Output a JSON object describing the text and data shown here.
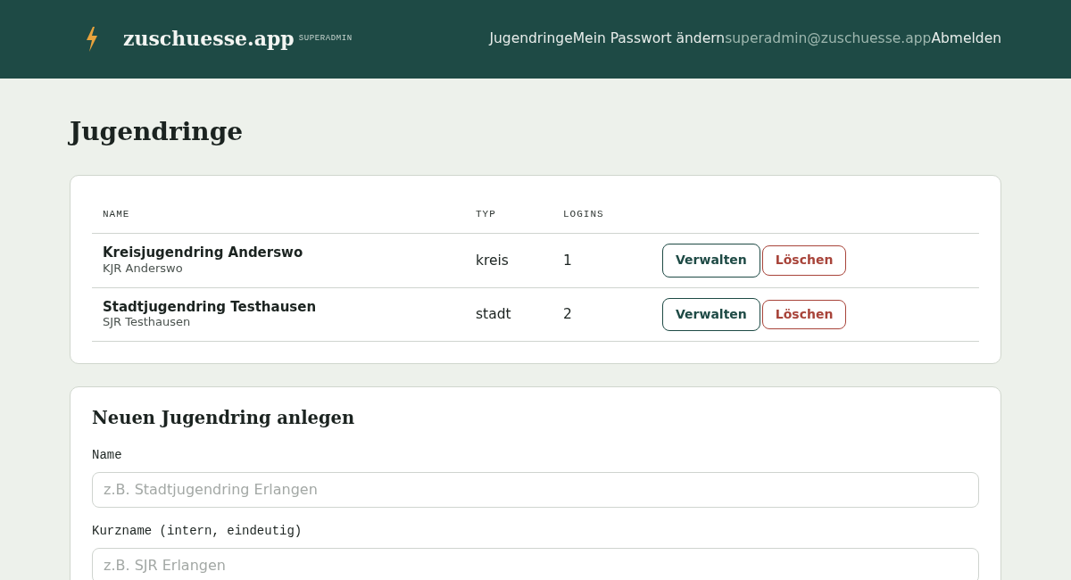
{
  "header": {
    "brand": "zuschuesse.app",
    "badge": "SUPERADMIN",
    "nav": [
      {
        "label": "Jugendringe",
        "kind": "link"
      },
      {
        "label": "Mein Passwort ändern",
        "kind": "link"
      },
      {
        "label": "superadmin@zuschuesse.app",
        "kind": "user"
      },
      {
        "label": "Abmelden",
        "kind": "link"
      }
    ]
  },
  "page_title": "Jugendringe",
  "table": {
    "columns": [
      "NAME",
      "TYP",
      "LOGINS"
    ],
    "rows": [
      {
        "name": "Kreisjugendring Anderswo",
        "short_name": "KJR Anderswo",
        "type": "kreis",
        "logins": "1",
        "actions": [
          {
            "label": "Verwalten",
            "kind": "manage"
          },
          {
            "label": "Löschen",
            "kind": "delete"
          }
        ]
      },
      {
        "name": "Stadtjugendring Testhausen",
        "short_name": "SJR Testhausen",
        "type": "stadt",
        "logins": "2",
        "actions": [
          {
            "label": "Verwalten",
            "kind": "manage"
          },
          {
            "label": "Löschen",
            "kind": "delete"
          }
        ]
      }
    ]
  },
  "form": {
    "title": "Neuen Jugendring anlegen",
    "fields": [
      {
        "label": "Name",
        "placeholder": "z.B. Stadtjugendring Erlangen"
      },
      {
        "label": "Kurzname (intern, eindeutig)",
        "placeholder": "z.B. SJR Erlangen"
      }
    ]
  }
}
